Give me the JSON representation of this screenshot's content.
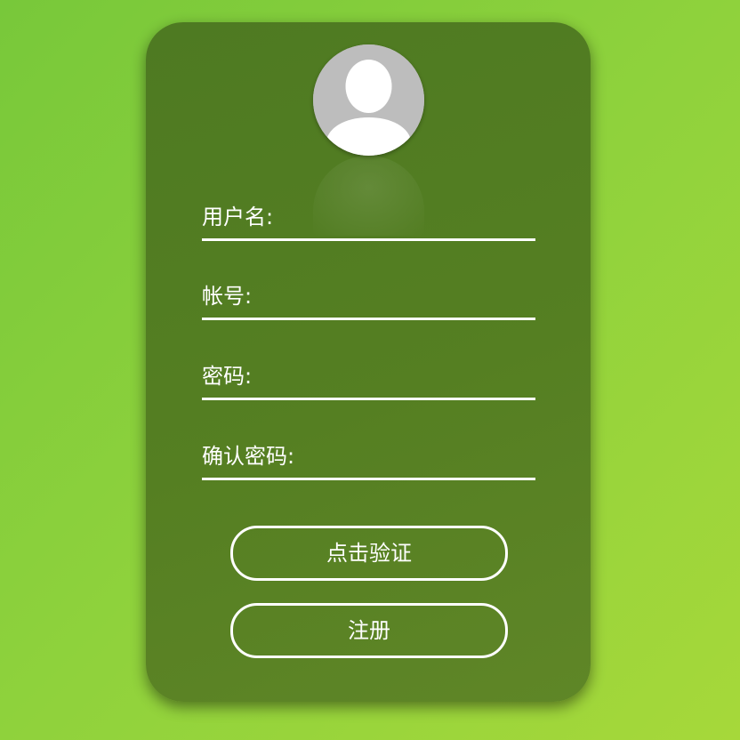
{
  "form": {
    "username_label": "用户名:",
    "account_label": "帐号:",
    "password_label": "密码:",
    "confirm_password_label": "确认密码:"
  },
  "buttons": {
    "verify_label": "点击验证",
    "register_label": "注册"
  },
  "colors": {
    "background_start": "#78c83a",
    "background_end": "#a6d83a",
    "card": "#557f22",
    "text": "#ffffff",
    "avatar_bg": "#bdbdbd"
  },
  "icons": {
    "avatar": "user-silhouette-icon"
  }
}
